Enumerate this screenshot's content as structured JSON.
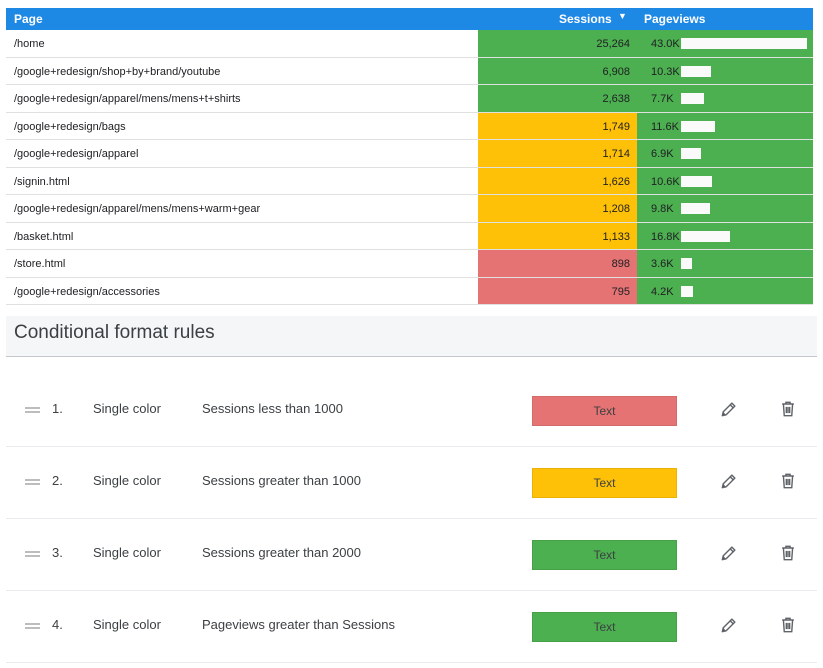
{
  "table": {
    "headers": {
      "page": "Page",
      "sessions": "Sessions",
      "sort_arrow": "▼",
      "pageviews": "Pageviews"
    },
    "rows": [
      {
        "page": "/home",
        "sessions": "25,264",
        "pageviews": "43.0K",
        "pv_value": 43.0,
        "color": "#4caf50"
      },
      {
        "page": "/google+redesign/shop+by+brand/youtube",
        "sessions": "6,908",
        "pageviews": "10.3K",
        "pv_value": 10.3,
        "color": "#4caf50"
      },
      {
        "page": "/google+redesign/apparel/mens/mens+t+shirts",
        "sessions": "2,638",
        "pageviews": "7.7K",
        "pv_value": 7.7,
        "color": "#4caf50"
      },
      {
        "page": "/google+redesign/bags",
        "sessions": "1,749",
        "pageviews": "11.6K",
        "pv_value": 11.6,
        "color": "#ffc107"
      },
      {
        "page": "/google+redesign/apparel",
        "sessions": "1,714",
        "pageviews": "6.9K",
        "pv_value": 6.9,
        "color": "#ffc107"
      },
      {
        "page": "/signin.html",
        "sessions": "1,626",
        "pageviews": "10.6K",
        "pv_value": 10.6,
        "color": "#ffc107"
      },
      {
        "page": "/google+redesign/apparel/mens/mens+warm+gear",
        "sessions": "1,208",
        "pageviews": "9.8K",
        "pv_value": 9.8,
        "color": "#ffc107"
      },
      {
        "page": "/basket.html",
        "sessions": "1,133",
        "pageviews": "16.8K",
        "pv_value": 16.8,
        "color": "#ffc107"
      },
      {
        "page": "/store.html",
        "sessions": "898",
        "pageviews": "3.6K",
        "pv_value": 3.6,
        "color": "#e57373"
      },
      {
        "page": "/google+redesign/accessories",
        "sessions": "795",
        "pageviews": "4.2K",
        "pv_value": 4.2,
        "color": "#e57373"
      }
    ],
    "pv_max": 43.0,
    "pageviews_color": "#4caf50"
  },
  "rules_panel": {
    "title": "Conditional format rules",
    "rules": [
      {
        "num": "1.",
        "type": "Single color",
        "condition": "Sessions less than 1000",
        "sample": "Text",
        "color": "#e57373"
      },
      {
        "num": "2.",
        "type": "Single color",
        "condition": "Sessions greater than 1000",
        "sample": "Text",
        "color": "#ffc107"
      },
      {
        "num": "3.",
        "type": "Single color",
        "condition": "Sessions greater than 2000",
        "sample": "Text",
        "color": "#4caf50"
      },
      {
        "num": "4.",
        "type": "Single color",
        "condition": "Pageviews greater than Sessions",
        "sample": "Text",
        "color": "#4caf50"
      }
    ],
    "icons": {
      "drag": "drag-handle-icon",
      "edit": "pencil-icon",
      "delete": "trash-icon"
    }
  }
}
